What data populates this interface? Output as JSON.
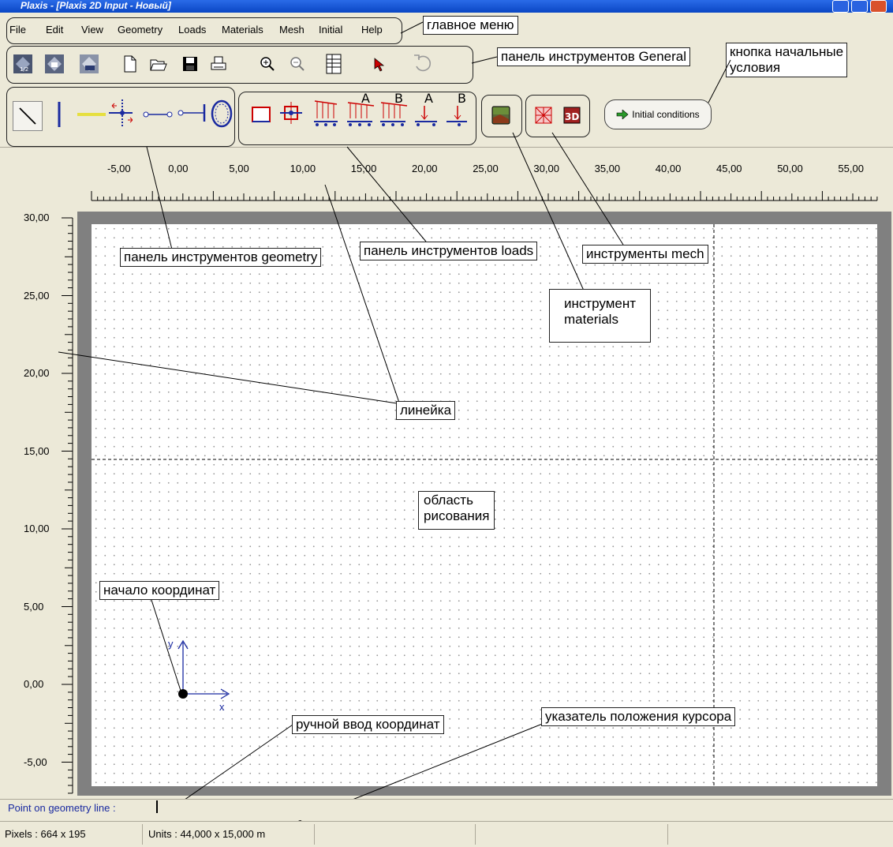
{
  "window": {
    "title": "Plaxis - [Plaxis 2D Input - Новый]"
  },
  "menu": [
    "File",
    "Edit",
    "View",
    "Geometry",
    "Loads",
    "Materials",
    "Mesh",
    "Initial",
    "Help"
  ],
  "toolbar_general": {
    "icons": [
      "plaxis-input-icon",
      "plaxis-calc-icon",
      "plaxis-output-icon",
      "new-file-icon",
      "open-folder-icon",
      "save-disk-icon",
      "print-icon",
      "zoom-in-icon",
      "zoom-out-icon",
      "table-icon",
      "selection-arrow-icon",
      "undo-icon"
    ]
  },
  "toolbar_geometry": {
    "icons": [
      "geometry-line-icon",
      "plate-icon",
      "geogrid-icon",
      "interface-icon",
      "node-to-node-anchor-icon",
      "fixed-end-anchor-icon",
      "tunnel-icon"
    ]
  },
  "toolbar_loads": {
    "icons": [
      "standard-fixities-icon",
      "horizontal-fixity-icon",
      "total-fixities-icon",
      "distributed-load-a-icon",
      "distributed-load-b-icon",
      "point-load-a-icon",
      "point-load-b-icon"
    ]
  },
  "toolbar_materials": {
    "icon": "material-sets-icon"
  },
  "toolbar_mesh": {
    "icons": [
      "generate-mesh-icon",
      "mesh-3d-icon"
    ]
  },
  "initial_conditions_button": {
    "label": "Initial conditions",
    "icon": "arrow-right-icon"
  },
  "ruler_x": [
    "-5,00",
    "0,00",
    "5,00",
    "10,00",
    "15,00",
    "20,00",
    "25,00",
    "30,00",
    "35,00",
    "40,00",
    "45,00",
    "50,00",
    "55,00"
  ],
  "ruler_y": [
    "30,00",
    "25,00",
    "20,00",
    "15,00",
    "10,00",
    "5,00",
    "0,00",
    "-5,00"
  ],
  "axes": {
    "x_label": "x",
    "y_label": "y"
  },
  "annotations": {
    "main_menu": "главное меню",
    "general_toolbar": "панель инструментов General",
    "initial_button_line1": "кнопка начальные",
    "initial_button_line2": "условия",
    "geometry_toolbar": "панель инструментов geometry",
    "loads_toolbar": "панель инструментов loads",
    "mesh_tools": "инструменты mech",
    "materials_line1": "инструмент",
    "materials_line2": "materials",
    "ruler": "линейка",
    "drawing_area_line1": "область",
    "drawing_area_line2": "рисования",
    "origin": "начало координат",
    "manual_input": "ручной ввод координат",
    "cursor_pointer": "указатель положения курсора"
  },
  "status": {
    "prompt": "Point on geometry line :",
    "pixels": "Pixels : 664 x 195",
    "units": "Units : 44,000 x 15,000 m"
  }
}
